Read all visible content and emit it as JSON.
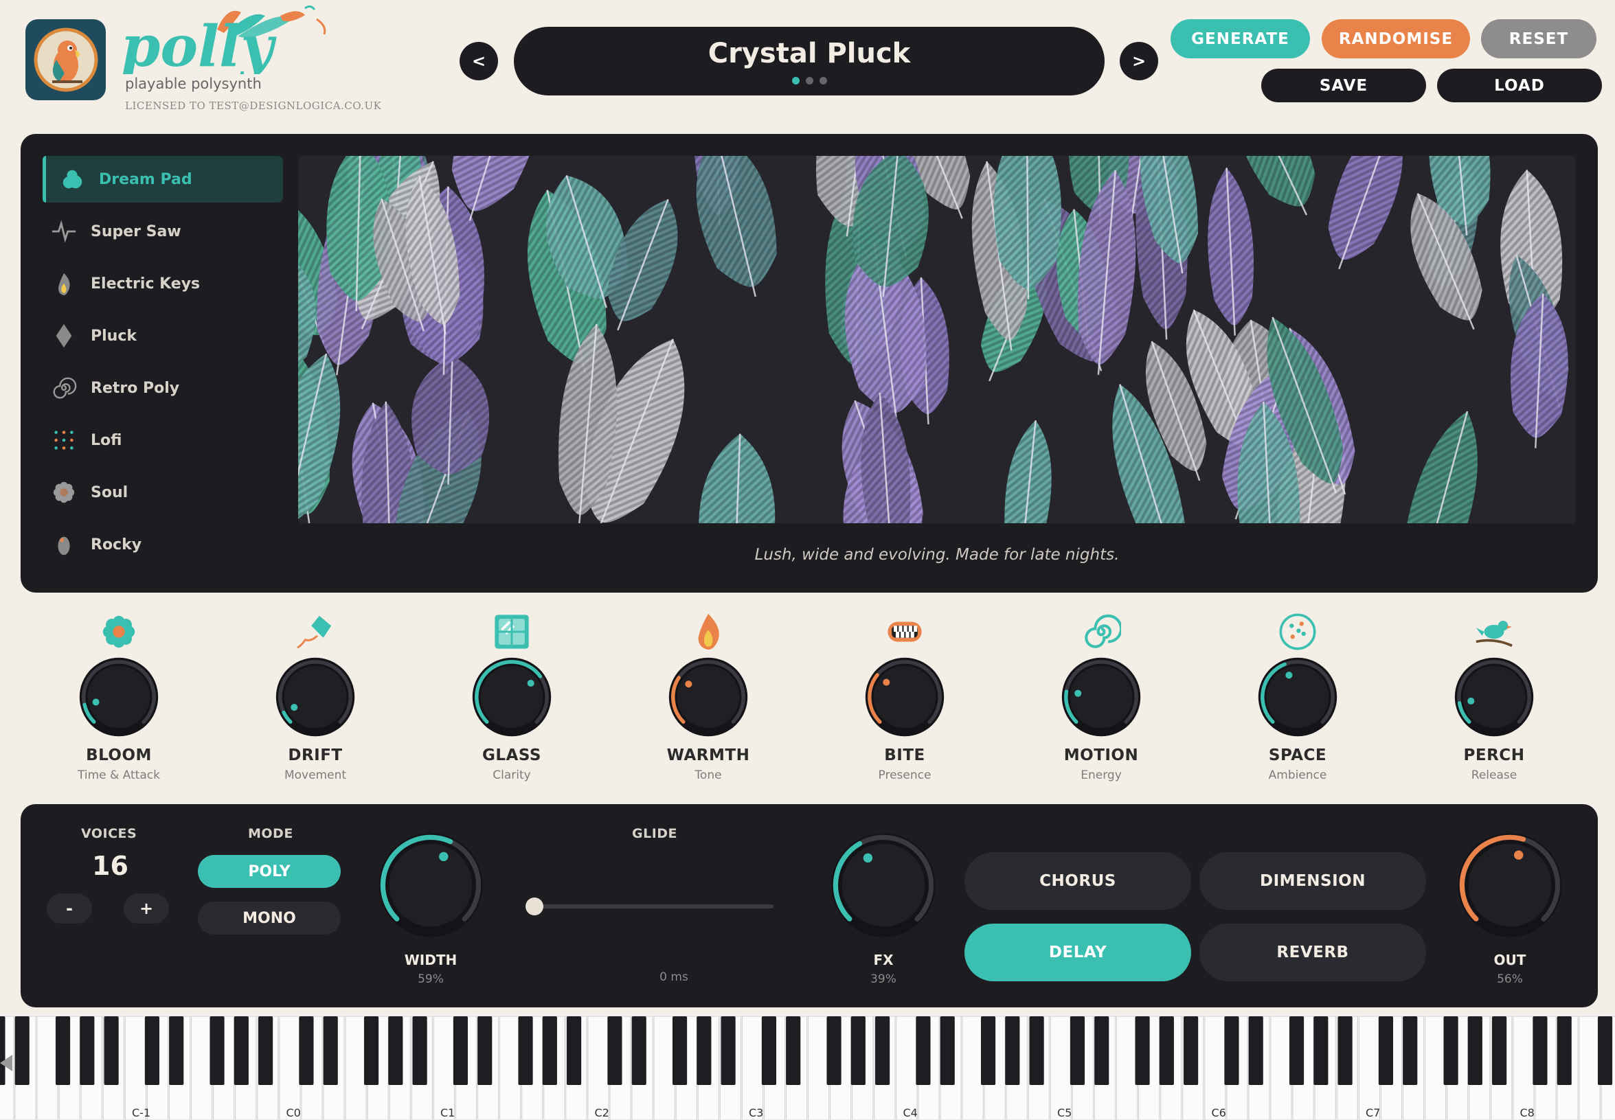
{
  "header": {
    "logo_text": "polly",
    "tagline": "playable polysynth",
    "license": "LICENSED TO TEST@DESIGNLOGICA.CO.UK",
    "prev_label": "<",
    "next_label": ">",
    "preset_name": "Crystal Pluck",
    "preset_page": 1,
    "preset_pages": 3,
    "generate_label": "GENERATE",
    "randomise_label": "RANDOMISE",
    "reset_label": "RESET",
    "save_label": "SAVE",
    "load_label": "LOAD"
  },
  "categories": [
    {
      "label": "Dream Pad",
      "icon": "cloud-icon",
      "active": true
    },
    {
      "label": "Super Saw",
      "icon": "waveform-icon",
      "active": false
    },
    {
      "label": "Electric Keys",
      "icon": "flame-icon",
      "active": false
    },
    {
      "label": "Pluck",
      "icon": "diamond-icon",
      "active": false
    },
    {
      "label": "Retro Poly",
      "icon": "spiral-icon",
      "active": false
    },
    {
      "label": "Lofi",
      "icon": "dot-grid-icon",
      "active": false
    },
    {
      "label": "Soul",
      "icon": "flower-icon",
      "active": false
    },
    {
      "label": "Rocky",
      "icon": "rock-icon",
      "active": false
    }
  ],
  "preset_description": "Lush, wide and evolving. Made for late nights.",
  "macros": [
    {
      "label": "BLOOM",
      "sub": "Time & Attack",
      "icon": "flower-icon",
      "value": 0.12,
      "color": "#3bbfb1"
    },
    {
      "label": "DRIFT",
      "sub": "Movement",
      "icon": "kite-icon",
      "value": 0.07,
      "color": "#3bbfb1"
    },
    {
      "label": "GLASS",
      "sub": "Clarity",
      "icon": "glass-pane-icon",
      "value": 0.7,
      "color": "#3bbfb1"
    },
    {
      "label": "WARMTH",
      "sub": "Tone",
      "icon": "fire-icon",
      "value": 0.29,
      "color": "#e9834a"
    },
    {
      "label": "BITE",
      "sub": "Presence",
      "icon": "teeth-icon",
      "value": 0.31,
      "color": "#e9834a"
    },
    {
      "label": "MOTION",
      "sub": "Energy",
      "icon": "swirl-icon",
      "value": 0.2,
      "color": "#3bbfb1"
    },
    {
      "label": "SPACE",
      "sub": "Ambience",
      "icon": "bubble-icon",
      "value": 0.42,
      "color": "#3bbfb1"
    },
    {
      "label": "PERCH",
      "sub": "Release",
      "icon": "bird-icon",
      "value": 0.13,
      "color": "#3bbfb1"
    }
  ],
  "bottom": {
    "voices_label": "VOICES",
    "voices_value": "16",
    "minus_label": "-",
    "plus_label": "+",
    "mode_label": "MODE",
    "poly_label": "POLY",
    "mono_label": "MONO",
    "mode": "POLY",
    "width_label": "WIDTH",
    "width_value": "59%",
    "width_level": 0.59,
    "glide_label": "GLIDE",
    "glide_value": "0 ms",
    "glide_level": 0,
    "fx_label": "FX",
    "fx_value": "39%",
    "fx_level": 0.39,
    "out_label": "OUT",
    "out_value": "56%",
    "out_level": 0.56,
    "fx_types": [
      {
        "label": "CHORUS",
        "active": false
      },
      {
        "label": "DIMENSION",
        "active": false
      },
      {
        "label": "DELAY",
        "active": true
      },
      {
        "label": "REVERB",
        "active": false
      }
    ]
  },
  "keyboard": {
    "octave_labels": [
      "C-1",
      "C0",
      "C1",
      "C2",
      "C3",
      "C4",
      "C5",
      "C6",
      "C7",
      "C8"
    ]
  },
  "colors": {
    "teal": "#3bbfb1",
    "orange": "#e9834a",
    "grey": "#8d8d8d",
    "dark": "#1c1c21",
    "cream": "#f4efe6"
  }
}
